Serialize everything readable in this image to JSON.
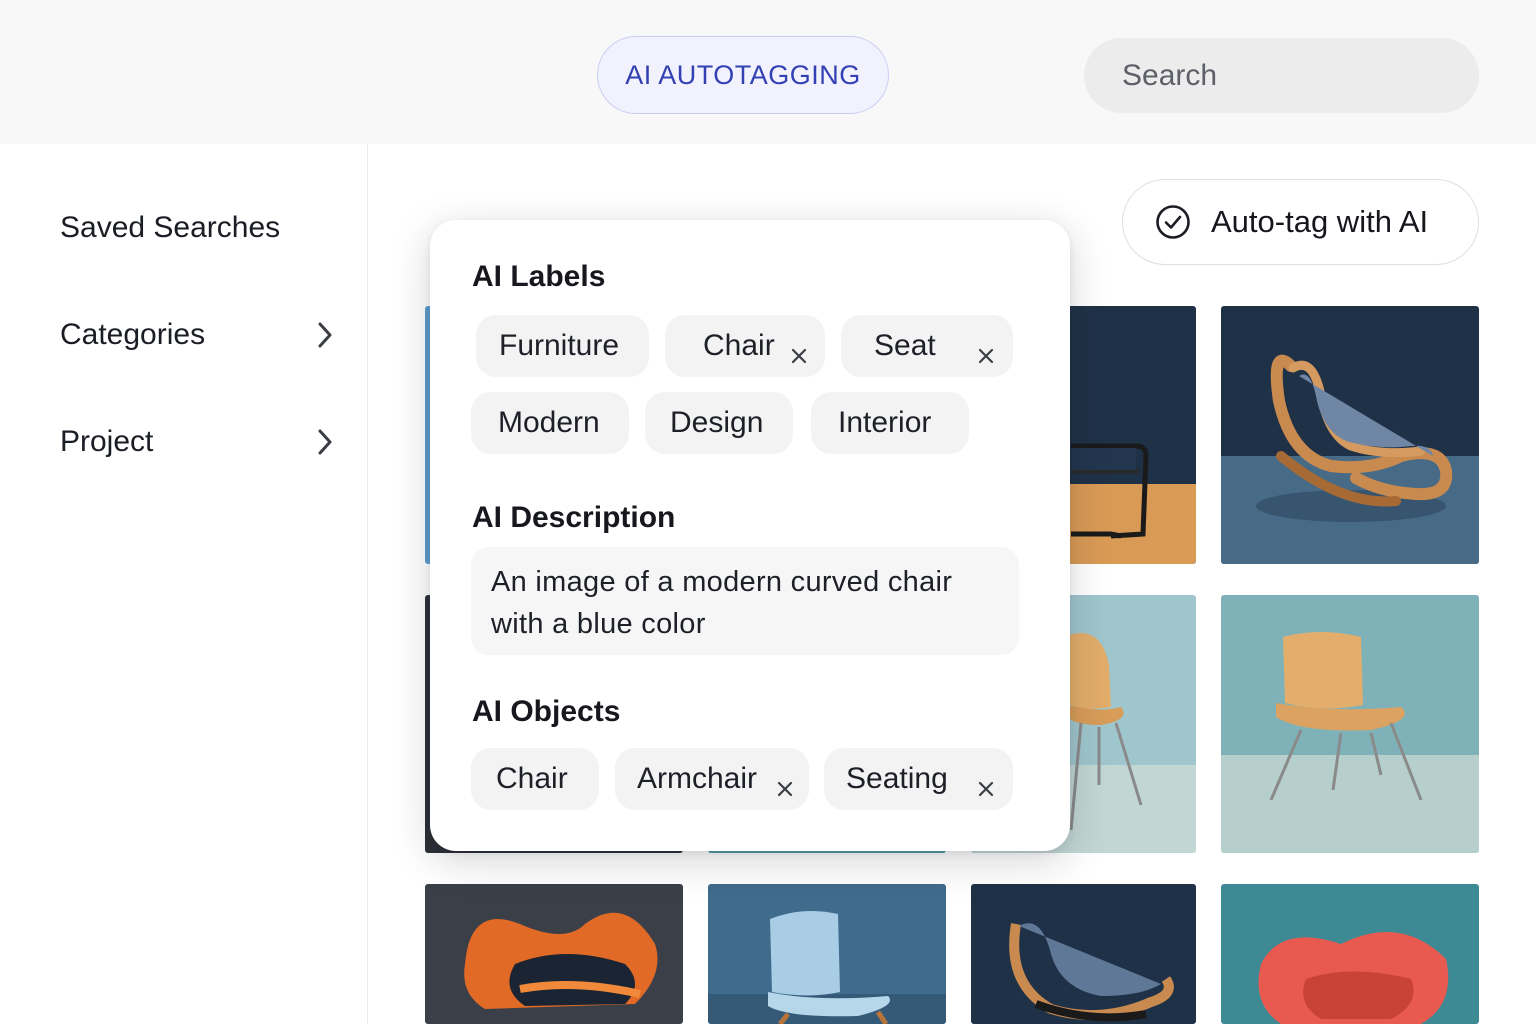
{
  "header": {
    "tab_label": "AI AUTOTAGGING",
    "search_placeholder": "Search"
  },
  "sidebar": {
    "items": [
      {
        "label": "Saved Searches",
        "has_chevron": false
      },
      {
        "label": "Categories",
        "has_chevron": true,
        "icon": "chevron-right-icon"
      },
      {
        "label": "Project",
        "has_chevron": true,
        "icon": "chevron-right-icon"
      }
    ]
  },
  "toolbar": {
    "autotag_label": "Auto-tag with AI",
    "autotag_icon": "check-circle-icon"
  },
  "panel": {
    "labels_heading": "AI Labels",
    "labels": [
      {
        "text": "Furniture",
        "removable": false
      },
      {
        "text": "Chair",
        "removable": true
      },
      {
        "text": "Seat",
        "removable": true
      },
      {
        "text": "Modern",
        "removable": false
      },
      {
        "text": "Design",
        "removable": false
      },
      {
        "text": "Interior",
        "removable": false
      }
    ],
    "description_heading": "AI Description",
    "description_line1": "An image of a modern curved chair",
    "description_line2": "with a blue color",
    "objects_heading": "AI Objects",
    "objects": [
      {
        "text": "Chair",
        "removable": false
      },
      {
        "text": "Armchair",
        "removable": true
      },
      {
        "text": "Seating",
        "removable": true
      }
    ]
  },
  "colors": {
    "accent": "#3240b4",
    "accent_border": "#c9cdf2",
    "chip_bg": "#f3f3f4"
  }
}
